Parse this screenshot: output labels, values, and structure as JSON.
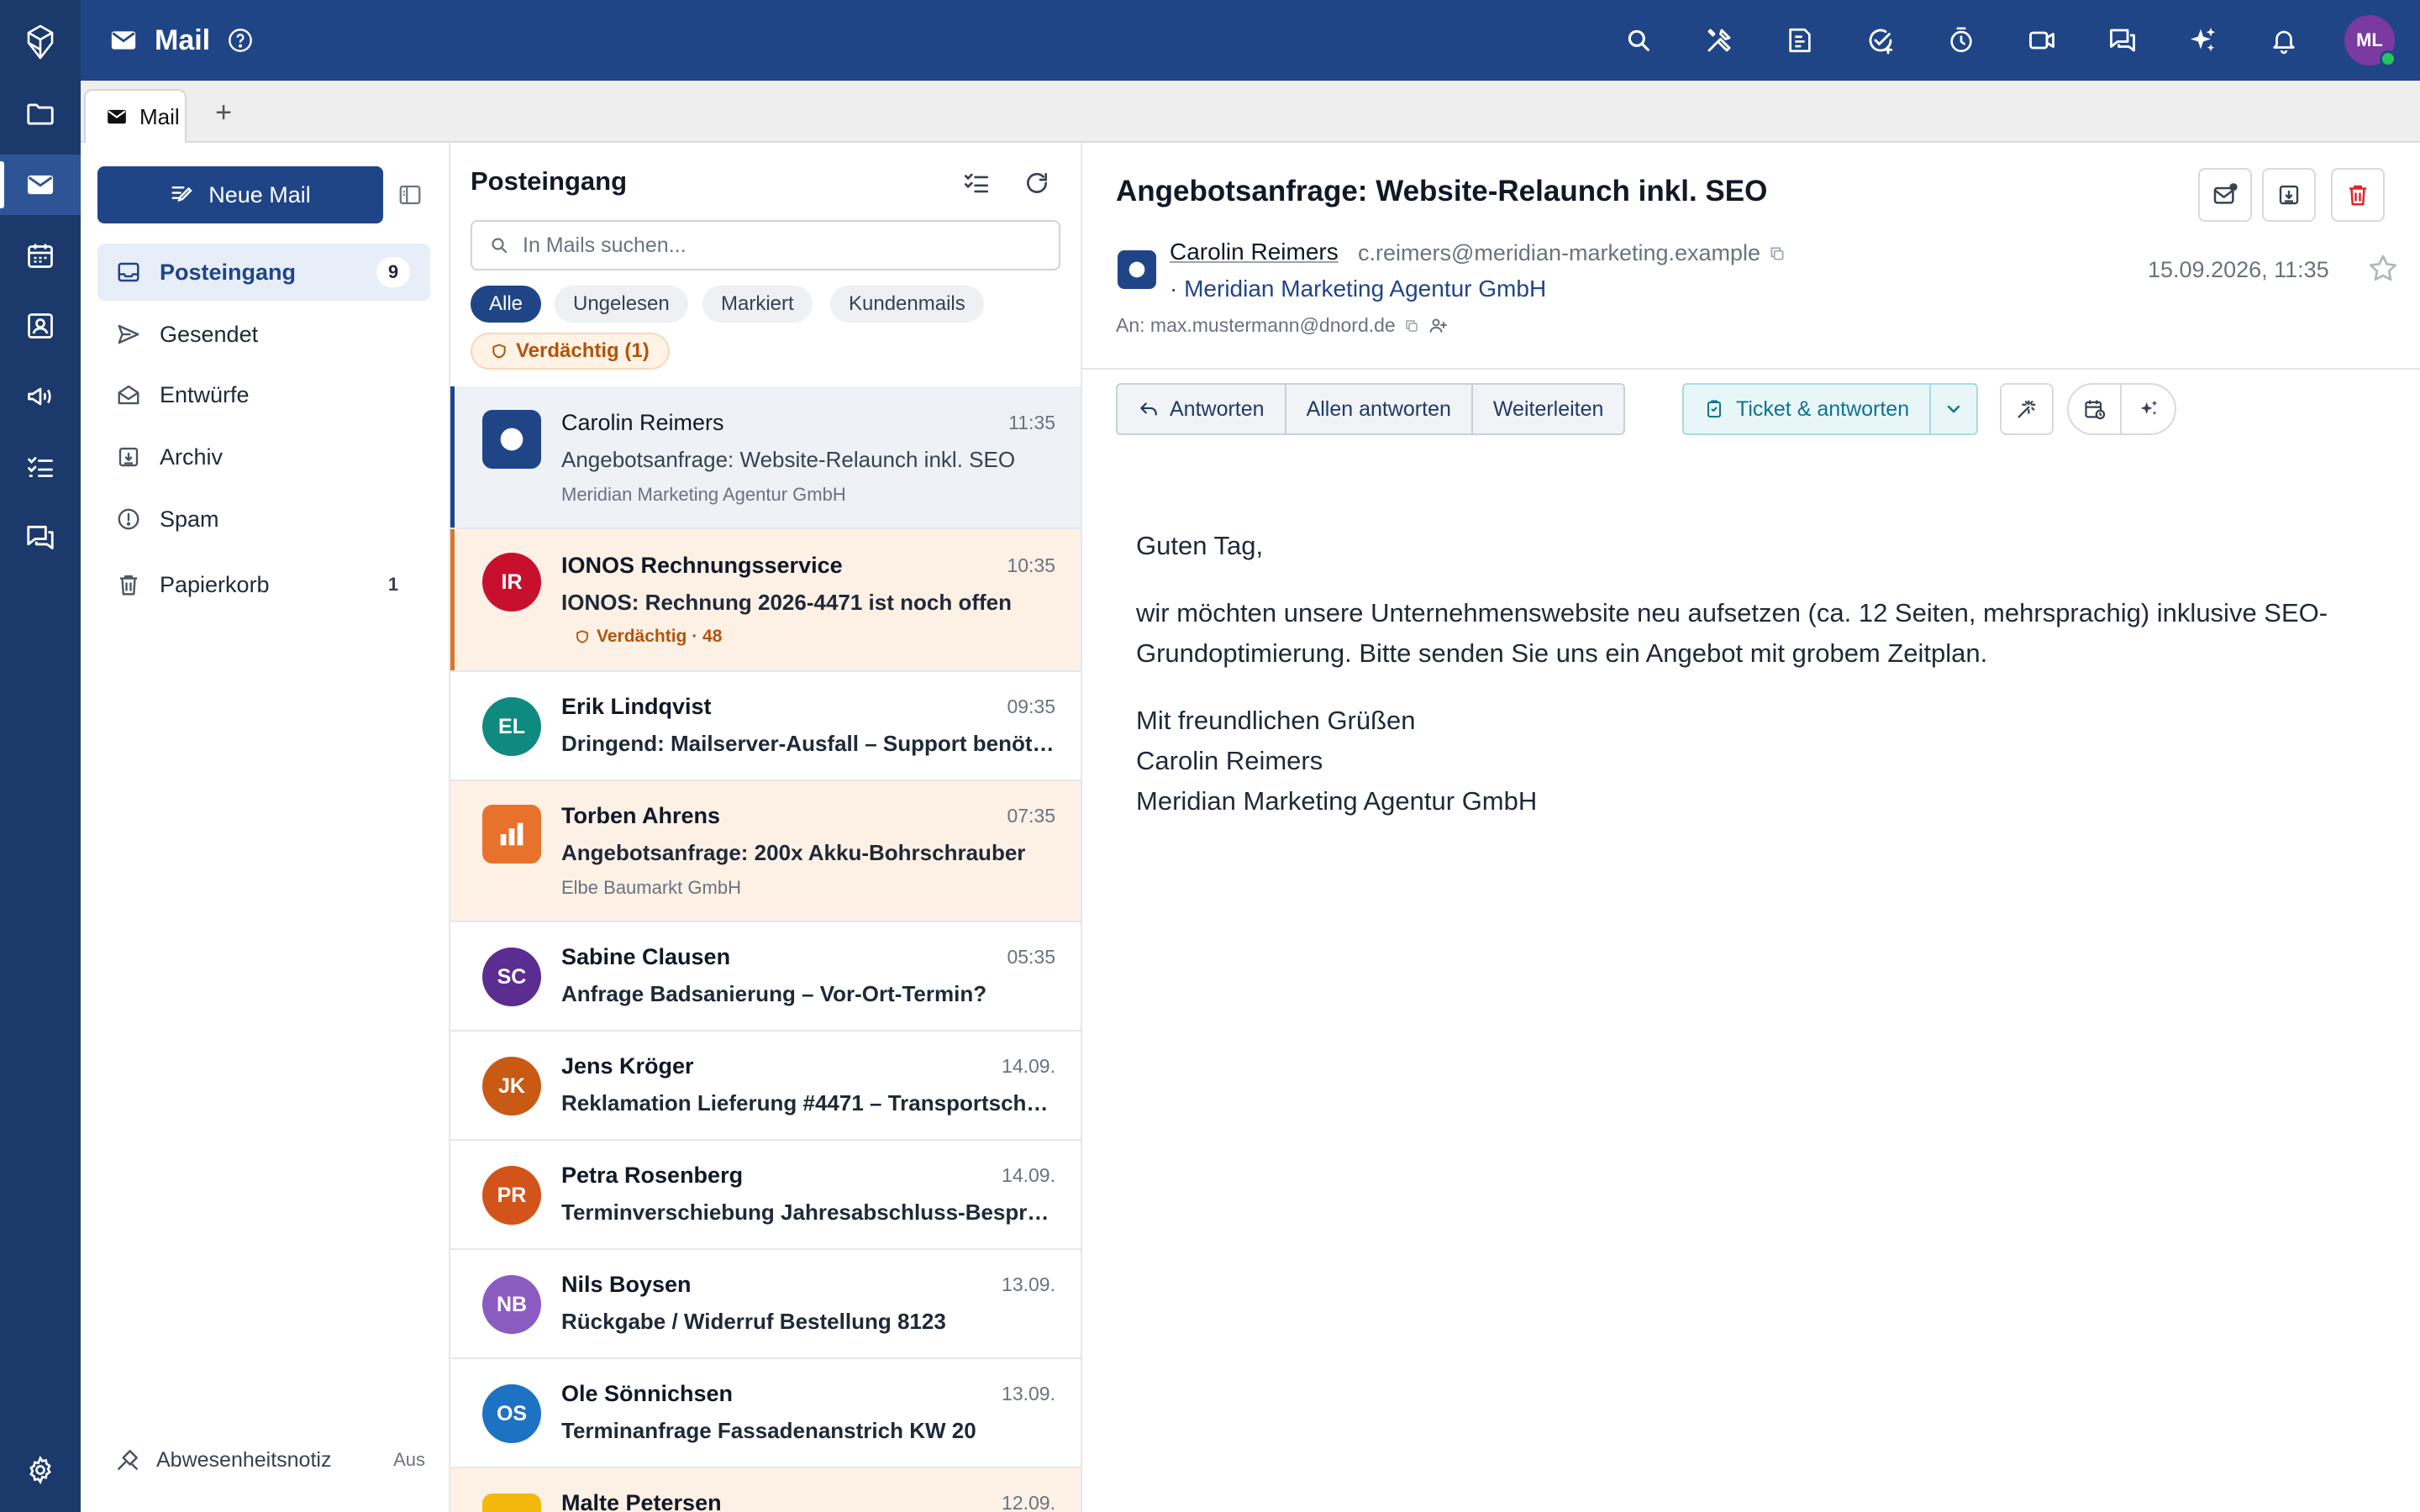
{
  "app": {
    "title": "Mail"
  },
  "tabs": [
    {
      "label": "Mail"
    }
  ],
  "compose_label": "Neue Mail",
  "folders": [
    {
      "label": "Posteingang",
      "count": "9",
      "icon": "inbox-icon"
    },
    {
      "label": "Gesendet",
      "count": "",
      "icon": "send-icon"
    },
    {
      "label": "Entwürfe",
      "count": "",
      "icon": "draft-icon"
    },
    {
      "label": "Archiv",
      "count": "",
      "icon": "archive-icon"
    },
    {
      "label": "Spam",
      "count": "",
      "icon": "spam-icon"
    },
    {
      "label": "Papierkorb",
      "count": "1",
      "icon": "trash-icon"
    }
  ],
  "out_of_office": {
    "label": "Abwesenheitsnotiz",
    "state": "Aus"
  },
  "list": {
    "title": "Posteingang",
    "search_placeholder": "In Mails suchen...",
    "filters": [
      "Alle",
      "Ungelesen",
      "Markiert",
      "Kundenmails"
    ],
    "suspicious_filter": "Verdächtig (1)",
    "rows": [
      {
        "sender": "Carolin Reimers",
        "time": "11:35",
        "subject": "Angebotsanfrage: Website-Relaunch inkl. SEO",
        "org": "Meridian Marketing Agentur GmbH",
        "avatar_color": "#1f4587"
      },
      {
        "sender": "IONOS Rechnungsservice",
        "time": "10:35",
        "subject": "IONOS: Rechnung 2026-4471 ist noch offen",
        "flag": "Verdächtig · 48",
        "initials": "IR",
        "avatar_color": "#c8102e"
      },
      {
        "sender": "Erik Lindqvist",
        "time": "09:35",
        "subject": "Dringend: Mailserver-Ausfall – Support benötigt",
        "initials": "EL",
        "avatar_color": "#0f8a80"
      },
      {
        "sender": "Torben Ahrens",
        "time": "07:35",
        "subject": "Angebotsanfrage: 200x Akku-Bohrschrauber",
        "org": "Elbe Baumarkt GmbH",
        "avatar_color": "#e8722c"
      },
      {
        "sender": "Sabine Clausen",
        "time": "05:35",
        "subject": "Anfrage Badsanierung – Vor-Ort-Termin?",
        "initials": "SC",
        "avatar_color": "#5b2d91"
      },
      {
        "sender": "Jens Kröger",
        "time": "14.09.",
        "subject": "Reklamation Lieferung #4471 – Transportschaden",
        "initials": "JK",
        "avatar_color": "#c85a14"
      },
      {
        "sender": "Petra Rosenberg",
        "time": "14.09.",
        "subject": "Terminverschiebung Jahresabschluss-Besprechung",
        "initials": "PR",
        "avatar_color": "#d2541a"
      },
      {
        "sender": "Nils Boysen",
        "time": "13.09.",
        "subject": "Rückgabe / Widerruf Bestellung 8123",
        "initials": "NB",
        "avatar_color": "#8a5cc2"
      },
      {
        "sender": "Ole Sönnichsen",
        "time": "13.09.",
        "subject": "Terminanfrage Fassadenanstrich KW 20",
        "initials": "OS",
        "avatar_color": "#1d72c4"
      },
      {
        "sender": "Malte Petersen",
        "time": "12.09.",
        "subject": "",
        "avatar_color": "#f2b90c"
      }
    ]
  },
  "reader": {
    "subject": "Angebotsanfrage: Website-Relaunch inkl. SEO",
    "from_name": "Carolin Reimers",
    "from_email": "c.reimers@meridian-marketing.example",
    "from_org": "· Meridian Marketing Agentur GmbH",
    "to": "An: max.mustermann@dnord.de",
    "date": "15.09.2026, 11:35",
    "actions": {
      "reply": "Antworten",
      "reply_all": "Allen antworten",
      "forward": "Weiterleiten",
      "ticket": "Ticket & antworten"
    },
    "body": {
      "greeting": "Guten Tag,",
      "paragraph": "wir möchten unsere Unternehmenswebsite neu aufsetzen (ca. 12 Seiten, mehrsprachig) inklusive SEO-Grundoptimierung. Bitte senden Sie uns ein Angebot mit grobem Zeitplan.",
      "closing": "Mit freundlichen Grüßen",
      "signature_name": "Carolin Reimers",
      "signature_org": "Meridian Marketing Agentur GmbH"
    }
  },
  "user": {
    "initials": "ML",
    "status": "online"
  },
  "colors": {
    "rail": "#1b3a6b",
    "topbar": "#1f4587",
    "accent": "#1f4587",
    "warning": "#b45309",
    "warning_bg": "#fdf1e6"
  }
}
